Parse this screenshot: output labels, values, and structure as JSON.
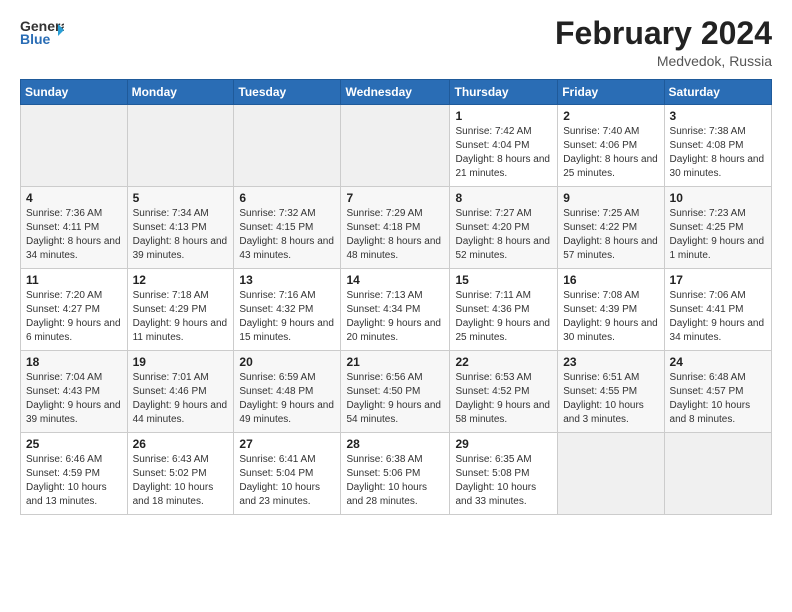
{
  "header": {
    "logo": {
      "general": "General",
      "blue": "Blue",
      "wing_color": "#2a9fd6"
    },
    "title": "February 2024",
    "location": "Medvedok, Russia"
  },
  "weekdays": [
    "Sunday",
    "Monday",
    "Tuesday",
    "Wednesday",
    "Thursday",
    "Friday",
    "Saturday"
  ],
  "weeks": [
    [
      {
        "day": "",
        "empty": true
      },
      {
        "day": "",
        "empty": true
      },
      {
        "day": "",
        "empty": true
      },
      {
        "day": "",
        "empty": true
      },
      {
        "day": "1",
        "sunrise": "7:42 AM",
        "sunset": "4:04 PM",
        "daylight": "8 hours and 21 minutes."
      },
      {
        "day": "2",
        "sunrise": "7:40 AM",
        "sunset": "4:06 PM",
        "daylight": "8 hours and 25 minutes."
      },
      {
        "day": "3",
        "sunrise": "7:38 AM",
        "sunset": "4:08 PM",
        "daylight": "8 hours and 30 minutes."
      }
    ],
    [
      {
        "day": "4",
        "sunrise": "7:36 AM",
        "sunset": "4:11 PM",
        "daylight": "8 hours and 34 minutes."
      },
      {
        "day": "5",
        "sunrise": "7:34 AM",
        "sunset": "4:13 PM",
        "daylight": "8 hours and 39 minutes."
      },
      {
        "day": "6",
        "sunrise": "7:32 AM",
        "sunset": "4:15 PM",
        "daylight": "8 hours and 43 minutes."
      },
      {
        "day": "7",
        "sunrise": "7:29 AM",
        "sunset": "4:18 PM",
        "daylight": "8 hours and 48 minutes."
      },
      {
        "day": "8",
        "sunrise": "7:27 AM",
        "sunset": "4:20 PM",
        "daylight": "8 hours and 52 minutes."
      },
      {
        "day": "9",
        "sunrise": "7:25 AM",
        "sunset": "4:22 PM",
        "daylight": "8 hours and 57 minutes."
      },
      {
        "day": "10",
        "sunrise": "7:23 AM",
        "sunset": "4:25 PM",
        "daylight": "9 hours and 1 minute."
      }
    ],
    [
      {
        "day": "11",
        "sunrise": "7:20 AM",
        "sunset": "4:27 PM",
        "daylight": "9 hours and 6 minutes."
      },
      {
        "day": "12",
        "sunrise": "7:18 AM",
        "sunset": "4:29 PM",
        "daylight": "9 hours and 11 minutes."
      },
      {
        "day": "13",
        "sunrise": "7:16 AM",
        "sunset": "4:32 PM",
        "daylight": "9 hours and 15 minutes."
      },
      {
        "day": "14",
        "sunrise": "7:13 AM",
        "sunset": "4:34 PM",
        "daylight": "9 hours and 20 minutes."
      },
      {
        "day": "15",
        "sunrise": "7:11 AM",
        "sunset": "4:36 PM",
        "daylight": "9 hours and 25 minutes."
      },
      {
        "day": "16",
        "sunrise": "7:08 AM",
        "sunset": "4:39 PM",
        "daylight": "9 hours and 30 minutes."
      },
      {
        "day": "17",
        "sunrise": "7:06 AM",
        "sunset": "4:41 PM",
        "daylight": "9 hours and 34 minutes."
      }
    ],
    [
      {
        "day": "18",
        "sunrise": "7:04 AM",
        "sunset": "4:43 PM",
        "daylight": "9 hours and 39 minutes."
      },
      {
        "day": "19",
        "sunrise": "7:01 AM",
        "sunset": "4:46 PM",
        "daylight": "9 hours and 44 minutes."
      },
      {
        "day": "20",
        "sunrise": "6:59 AM",
        "sunset": "4:48 PM",
        "daylight": "9 hours and 49 minutes."
      },
      {
        "day": "21",
        "sunrise": "6:56 AM",
        "sunset": "4:50 PM",
        "daylight": "9 hours and 54 minutes."
      },
      {
        "day": "22",
        "sunrise": "6:53 AM",
        "sunset": "4:52 PM",
        "daylight": "9 hours and 58 minutes."
      },
      {
        "day": "23",
        "sunrise": "6:51 AM",
        "sunset": "4:55 PM",
        "daylight": "10 hours and 3 minutes."
      },
      {
        "day": "24",
        "sunrise": "6:48 AM",
        "sunset": "4:57 PM",
        "daylight": "10 hours and 8 minutes."
      }
    ],
    [
      {
        "day": "25",
        "sunrise": "6:46 AM",
        "sunset": "4:59 PM",
        "daylight": "10 hours and 13 minutes."
      },
      {
        "day": "26",
        "sunrise": "6:43 AM",
        "sunset": "5:02 PM",
        "daylight": "10 hours and 18 minutes."
      },
      {
        "day": "27",
        "sunrise": "6:41 AM",
        "sunset": "5:04 PM",
        "daylight": "10 hours and 23 minutes."
      },
      {
        "day": "28",
        "sunrise": "6:38 AM",
        "sunset": "5:06 PM",
        "daylight": "10 hours and 28 minutes."
      },
      {
        "day": "29",
        "sunrise": "6:35 AM",
        "sunset": "5:08 PM",
        "daylight": "10 hours and 33 minutes."
      },
      {
        "day": "",
        "empty": true
      },
      {
        "day": "",
        "empty": true
      }
    ]
  ],
  "labels": {
    "sunrise": "Sunrise:",
    "sunset": "Sunset:",
    "daylight": "Daylight:"
  }
}
